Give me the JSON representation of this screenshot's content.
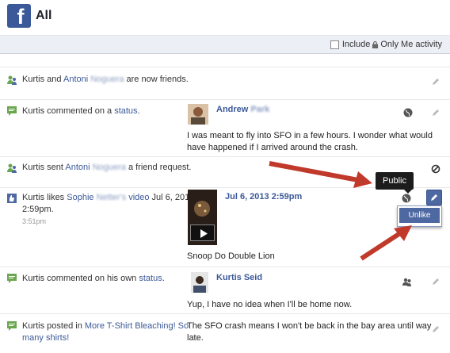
{
  "header": {
    "title": "All",
    "logo": "f"
  },
  "filter": {
    "label_before": "Include",
    "label_after": "Only Me activity"
  },
  "rows": [
    {
      "actor": "Kurtis",
      "and": " and ",
      "friend_first": "Antoni",
      "friend_last": "Noguera",
      "suffix": " are now friends."
    },
    {
      "actor": "Kurtis",
      "middle": " commented on a ",
      "link": "status",
      "end": ".",
      "preview_name_first": "Andrew",
      "preview_name_last": "Park",
      "preview_line1": "I was meant to fly into SFO in a few hours. I wonder what would",
      "preview_line2": "have happened if I arrived around the crash."
    },
    {
      "actor": "Kurtis",
      "middle": " sent ",
      "friend_first": "Antoni",
      "friend_last": "Noguera",
      "suffix": " a friend request."
    },
    {
      "actor": "Kurtis",
      "middle": " likes ",
      "friend_first": "Sophie",
      "friend_last": "Netter's",
      "link": "video",
      "date_tail": " Jul 6, 2013",
      "time_line": "2:59pm.",
      "meta": "3:51pm",
      "preview_date": "Jul 6, 2013 2:59pm",
      "preview_caption": "Snoop Do Double Lion"
    },
    {
      "actor": "Kurtis",
      "middle": " commented on his own ",
      "link": "status",
      "end": ".",
      "preview_name": "Kurtis Seid",
      "preview_line1": "Yup, I have no idea when I'll be home now."
    },
    {
      "actor": "Kurtis",
      "middle": " posted in ",
      "link1": "More T-Shirt Bleaching! So",
      "link2": "many shirts!",
      "preview_line1": "The SFO crash means I won't be back in the bay area until way",
      "preview_line2": "late."
    }
  ],
  "tooltip": {
    "text": "Public"
  },
  "menu": {
    "unlike": "Unlike"
  },
  "colors": {
    "brand": "#3b5998",
    "arrow": "#c0392b"
  }
}
